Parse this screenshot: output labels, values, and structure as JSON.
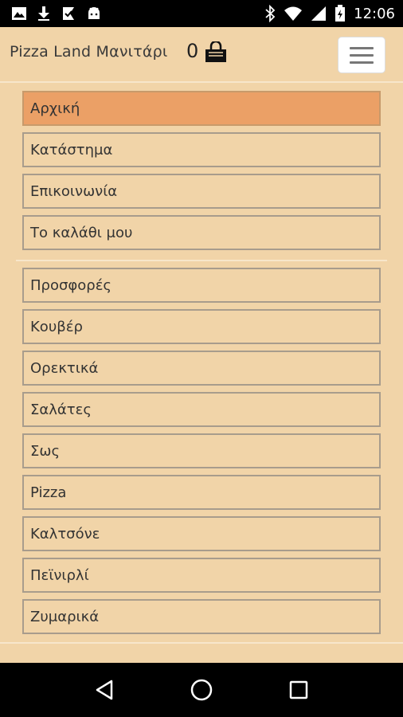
{
  "status_bar": {
    "time": "12:06",
    "left_icons": [
      "image-icon",
      "download-icon",
      "task-icon",
      "android-icon"
    ],
    "right_icons": [
      "bluetooth-icon",
      "wifi-icon",
      "signal-icon",
      "battery-icon"
    ]
  },
  "header": {
    "brand": "Pizza Land Μανιτάρι",
    "cart_count": "0"
  },
  "menu": {
    "primary": [
      {
        "label": "Αρχική",
        "active": true
      },
      {
        "label": "Κατάστημα",
        "active": false
      },
      {
        "label": "Επικοινωνία",
        "active": false
      },
      {
        "label": "Το καλάθι μου",
        "active": false
      }
    ],
    "categories": [
      {
        "label": "Προσφορές"
      },
      {
        "label": "Κουβέρ"
      },
      {
        "label": "Ορεκτικά"
      },
      {
        "label": "Σαλάτες"
      },
      {
        "label": "Σως"
      },
      {
        "label": "Pizza"
      },
      {
        "label": "Καλτσόνε"
      },
      {
        "label": "Πεϊνιρλί"
      },
      {
        "label": "Ζυμαρικά"
      }
    ]
  },
  "colors": {
    "background": "#f1d4a8",
    "active_item": "#eba066",
    "item_border": "#a89c8c"
  }
}
